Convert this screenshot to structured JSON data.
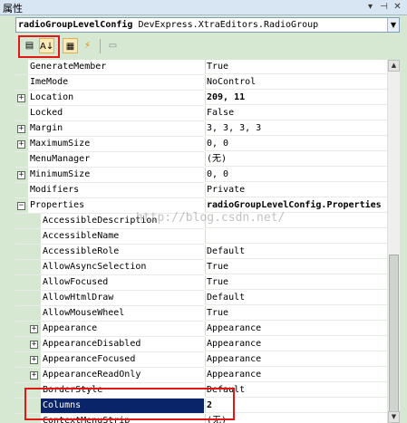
{
  "window": {
    "title": "属性"
  },
  "object_selector": {
    "object_name": "radioGroupLevelConfig",
    "object_type": "DevExpress.XtraEditors.RadioGroup"
  },
  "toolbar": {
    "buttons": [
      {
        "icon": "categorized-icon",
        "glyph": "▤",
        "active": false
      },
      {
        "icon": "alphabetical-sort-icon",
        "glyph": "A↓",
        "active": true
      },
      {
        "icon": "properties-icon",
        "glyph": "▦",
        "active": true
      },
      {
        "icon": "events-icon",
        "glyph": "⚡",
        "active": false
      },
      {
        "icon": "property-pages-icon",
        "glyph": "▭",
        "active": false
      }
    ]
  },
  "watermark": "http://blog.csdn.net/",
  "properties": [
    {
      "name": "GenerateMember",
      "value": "True"
    },
    {
      "name": "ImeMode",
      "value": "NoControl"
    },
    {
      "name": "Location",
      "value": "209, 11",
      "expandable": true,
      "bold_value": true
    },
    {
      "name": "Locked",
      "value": "False"
    },
    {
      "name": "Margin",
      "value": "3, 3, 3, 3",
      "expandable": true
    },
    {
      "name": "MaximumSize",
      "value": "0, 0",
      "expandable": true
    },
    {
      "name": "MenuManager",
      "value": "(无)"
    },
    {
      "name": "MinimumSize",
      "value": "0, 0",
      "expandable": true
    },
    {
      "name": "Modifiers",
      "value": "Private"
    },
    {
      "name": "Properties",
      "value": "radioGroupLevelConfig.Properties",
      "expanded": true,
      "bold_value": true
    },
    {
      "name": "AccessibleDescription",
      "value": "",
      "nested": true
    },
    {
      "name": "AccessibleName",
      "value": "",
      "nested": true
    },
    {
      "name": "AccessibleRole",
      "value": "Default",
      "nested": true
    },
    {
      "name": "AllowAsyncSelection",
      "value": "True",
      "nested": true
    },
    {
      "name": "AllowFocused",
      "value": "True",
      "nested": true
    },
    {
      "name": "AllowHtmlDraw",
      "value": "Default",
      "nested": true
    },
    {
      "name": "AllowMouseWheel",
      "value": "True",
      "nested": true
    },
    {
      "name": "Appearance",
      "value": "Appearance",
      "nested": true,
      "expandable": true
    },
    {
      "name": "AppearanceDisabled",
      "value": "Appearance",
      "nested": true,
      "expandable": true
    },
    {
      "name": "AppearanceFocused",
      "value": "Appearance",
      "nested": true,
      "expandable": true
    },
    {
      "name": "AppearanceReadOnly",
      "value": "Appearance",
      "nested": true,
      "expandable": true
    },
    {
      "name": "BorderStyle",
      "value": "Default",
      "nested": true
    },
    {
      "name": "Columns",
      "value": "2",
      "nested": true,
      "selected": true
    },
    {
      "name": "ContextMenuStrip",
      "value": "(无)",
      "nested": true
    }
  ]
}
